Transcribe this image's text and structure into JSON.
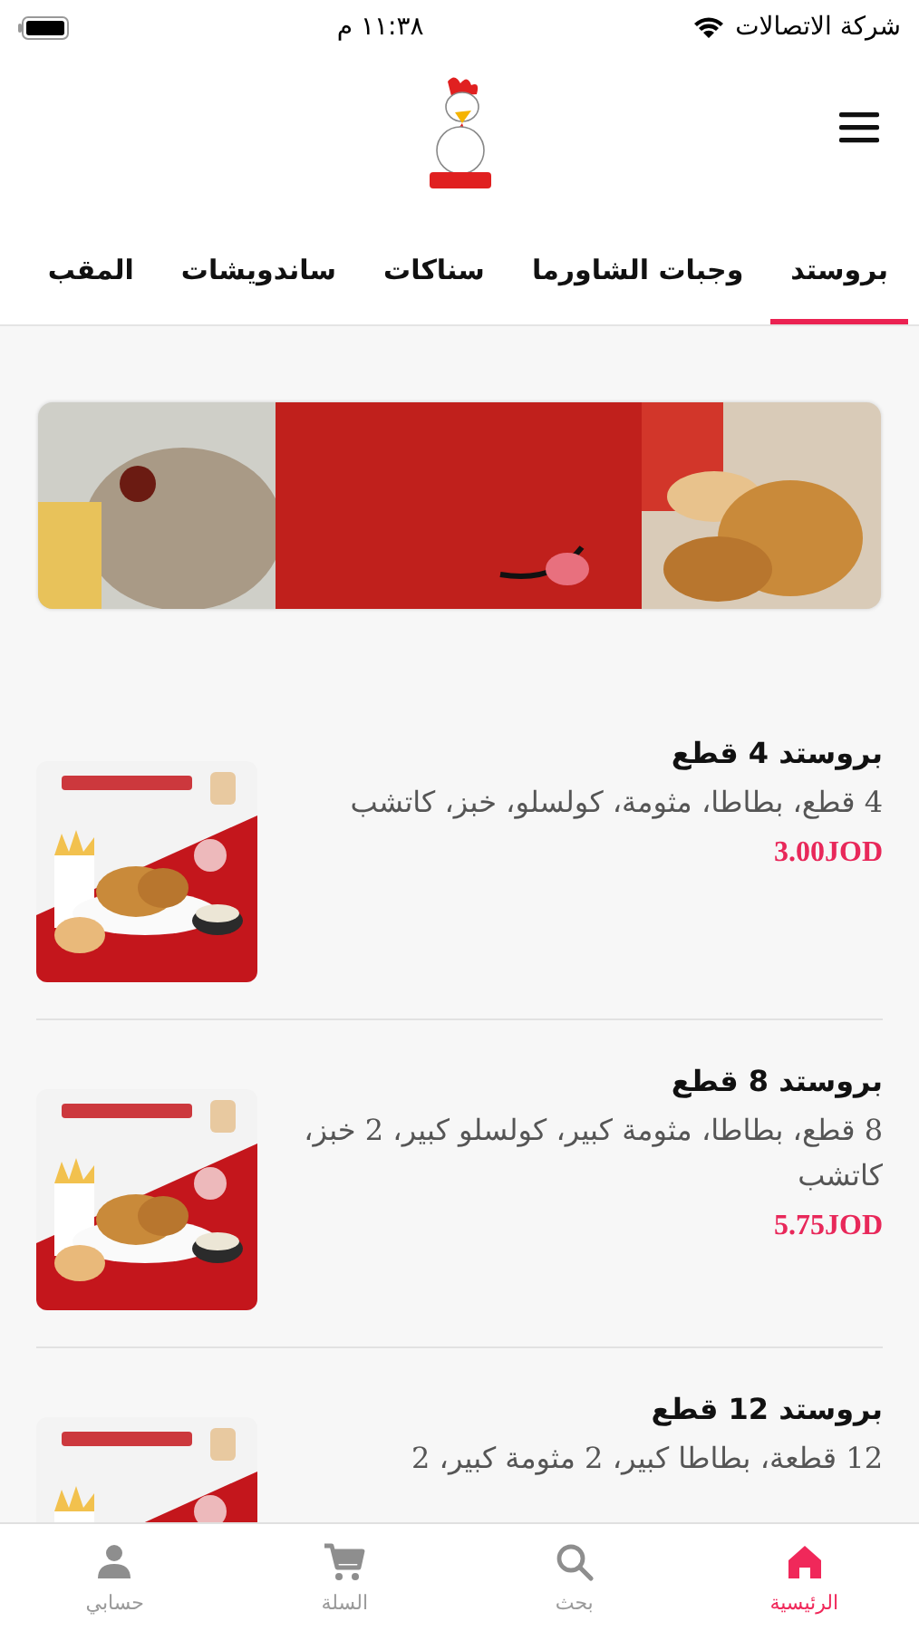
{
  "status_bar": {
    "carrier": "شركة الاتصالات",
    "time": "١١:٣٨ م"
  },
  "tabs": [
    {
      "label": "بروستد",
      "selected": true
    },
    {
      "label": "وجبات الشاورما",
      "selected": false
    },
    {
      "label": "سناكات",
      "selected": false
    },
    {
      "label": "ساندويشات",
      "selected": false
    },
    {
      "label": "المقب",
      "selected": false
    }
  ],
  "items": [
    {
      "title": "بروستد 4 قطع",
      "description": "4 قطع، بطاطا، مثومة، كولسلو، خبز، كاتشب",
      "price": "3.00JOD"
    },
    {
      "title": "بروستد 8 قطع",
      "description": "8 قطع، بطاطا، مثومة كبير، كولسلو كبير، 2 خبز، كاتشب",
      "price": "5.75JOD"
    },
    {
      "title": "بروستد 12 قطع",
      "description": "12 قطعة، بطاطا كبير، 2 مثومة كبير، 2"
    }
  ],
  "bottom_nav": [
    {
      "kind": "home",
      "label": "الرئيسية",
      "selected": true
    },
    {
      "kind": "search",
      "label": "بحث",
      "selected": false
    },
    {
      "kind": "cart",
      "label": "السلة",
      "selected": false
    },
    {
      "kind": "account",
      "label": "حسابي",
      "selected": false
    }
  ]
}
